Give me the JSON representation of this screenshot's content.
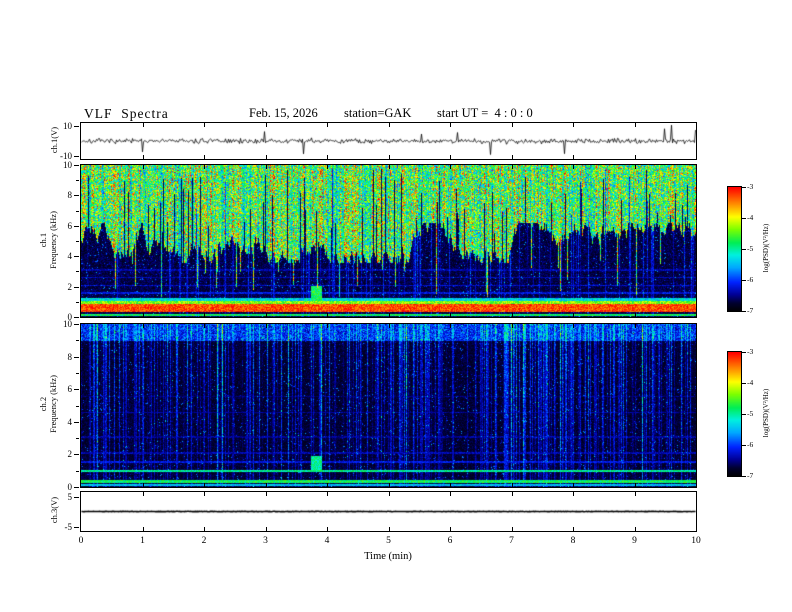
{
  "header": {
    "title": "VLF  Spectra",
    "date": "Feb. 15, 2026",
    "station_label": "station=GAK",
    "start_ut_label": "start UT =  4 : 0 : 0"
  },
  "xaxis": {
    "label": "Time (min)",
    "min": 0,
    "max": 10,
    "ticks": [
      0,
      1,
      2,
      3,
      4,
      5,
      6,
      7,
      8,
      9,
      10
    ]
  },
  "colorbar": {
    "label": "log(PSD)(V²/Hz)",
    "ticks": [
      -3,
      -4,
      -5,
      -6,
      -7
    ],
    "top_value": -3,
    "bottom_value": -7
  },
  "colormap_stops": [
    [
      0.0,
      "#000006"
    ],
    [
      0.06,
      "#00002f"
    ],
    [
      0.13,
      "#000096"
    ],
    [
      0.23,
      "#0022ff"
    ],
    [
      0.35,
      "#00aaff"
    ],
    [
      0.45,
      "#00f0e0"
    ],
    [
      0.55,
      "#00ee55"
    ],
    [
      0.66,
      "#7dff00"
    ],
    [
      0.76,
      "#ffff00"
    ],
    [
      0.87,
      "#ff8800"
    ],
    [
      1.0,
      "#ff0000"
    ]
  ],
  "chart_data": [
    {
      "id": "ch1_waveform",
      "type": "line",
      "ylabel": "ch.1(V)",
      "units": "V",
      "ylim": [
        -12,
        12
      ],
      "yticks": [
        10,
        -10
      ],
      "seed": 7,
      "noise_amp": 2.4,
      "spike_prob": 0.022,
      "spike_amp": 9,
      "line_width": 0.8,
      "description": "broadband noise around 0 V with intermittent impulsive spikes reaching about ±10 V over 0–10 min"
    },
    {
      "id": "ch1_spectrogram",
      "type": "heatmap",
      "channel": "ch.1",
      "ylabel": "Frequency (kHz)",
      "ylim": [
        0,
        10
      ],
      "yticks": [
        10,
        8,
        6,
        4,
        2,
        0
      ],
      "yminor": [
        9,
        7,
        5,
        3,
        1
      ],
      "zlabel": "log(PSD)(V²/Hz)",
      "zrange": [
        -7,
        -3
      ],
      "seed": 42,
      "model": {
        "upper_emission": {
          "enabled": true,
          "boundary_khz": 4.9,
          "boundary_jitter": 1.3,
          "mean": 0.5,
          "var": 0.55
        },
        "floor": {
          "mean": 0.03,
          "var": 0.09,
          "speckle_prob": 0.05,
          "speckle_gain": 0.3
        },
        "streaks": {
          "prob": 0.16,
          "gain_min": 0.06,
          "gain_max": 0.32
        },
        "dark_columns_prob": 0.1,
        "bright_columns_prob": 0.055,
        "hlines": [
          {
            "f": 0.62,
            "halfwidth": 0.27,
            "v": 0.93,
            "jitter": 0.18
          },
          {
            "f": 0.97,
            "halfwidth": 0.1,
            "v": 0.66,
            "jitter": 0.22
          },
          {
            "f": 1.18,
            "halfwidth": 0.08,
            "v": 0.42,
            "jitter": 0.2
          },
          {
            "f": 0.17,
            "halfwidth": 0.09,
            "v": 0.55,
            "jitter": 0.15
          },
          {
            "f": 1.62,
            "halfwidth": 0.05,
            "v": 0.2,
            "jitter": 0.12
          },
          {
            "f": 2.12,
            "halfwidth": 0.05,
            "v": 0.18,
            "jitter": 0.12
          },
          {
            "f": 2.62,
            "halfwidth": 0.05,
            "v": 0.16,
            "jitter": 0.1
          },
          {
            "f": 3.12,
            "halfwidth": 0.04,
            "v": 0.15,
            "jitter": 0.1
          }
        ],
        "blob": {
          "t": 3.82,
          "f": 1.5,
          "dt": 0.09,
          "df": 0.55,
          "v": 0.55
        },
        "description": "strong green/yellow impulsive hiss above ~5 kHz with ragged lower edge, dark band 1.5–5 kHz crossed by faint horizontal lines and vertical streaks, intense red band near 0.4–0.9 kHz, green narrowband line near 0.2 kHz, small green patch near t=3.8 min / 1.5 kHz"
      }
    },
    {
      "id": "ch2_spectrogram",
      "type": "heatmap",
      "channel": "ch.2",
      "ylabel": "Frequency (kHz)",
      "ylim": [
        0,
        10
      ],
      "yticks": [
        10,
        8,
        6,
        4,
        2,
        0
      ],
      "yminor": [
        9,
        7,
        5,
        3,
        1
      ],
      "zlabel": "log(PSD)(V²/Hz)",
      "zrange": [
        -7,
        -3
      ],
      "seed": 1234,
      "model": {
        "upper_emission": {
          "enabled": false
        },
        "floor": {
          "mean": 0.025,
          "var": 0.07,
          "speckle_prob": 0.05,
          "speckle_gain": 0.28
        },
        "streaks": {
          "prob": 0.42,
          "gain_min": 0.04,
          "gain_max": 0.34
        },
        "green_columns_prob": 0.02,
        "top_enhance": {
          "fmin": 9.0,
          "mean_add": 0.07,
          "var_add": 0.2
        },
        "hlines": [
          {
            "f": 1.02,
            "halfwidth": 0.08,
            "v": 0.5,
            "jitter": 0.15
          },
          {
            "f": 0.38,
            "halfwidth": 0.11,
            "v": 0.55,
            "jitter": 0.15
          },
          {
            "f": 0.15,
            "halfwidth": 0.06,
            "v": 0.38,
            "jitter": 0.12
          },
          {
            "f": 1.55,
            "halfwidth": 0.05,
            "v": 0.2,
            "jitter": 0.1
          },
          {
            "f": 2.1,
            "halfwidth": 0.05,
            "v": 0.15,
            "jitter": 0.1
          },
          {
            "f": 3.1,
            "halfwidth": 0.04,
            "v": 0.13,
            "jitter": 0.1
          },
          {
            "f": 4.6,
            "halfwidth": 0.04,
            "v": 0.13,
            "jitter": 0.08
          },
          {
            "f": 5.6,
            "halfwidth": 0.04,
            "v": 0.11,
            "jitter": 0.08
          }
        ],
        "blob": {
          "t": 3.82,
          "f": 1.45,
          "dt": 0.09,
          "df": 0.5,
          "v": 0.5
        },
        "description": "mostly dark background crossed by dense blue/cyan vertical impulsive streaks; narrowband cyan line near 1 kHz, green band near 0.4 kHz, faint lines near 2, 3, 4.6 and 5.6 kHz, small green patch near t=3.8 min / 1.5 kHz"
      }
    },
    {
      "id": "ch3_waveform",
      "type": "line",
      "ylabel": "ch.3(V)",
      "units": "V",
      "ylim": [
        -6.5,
        6.5
      ],
      "yticks": [
        5,
        -5
      ],
      "seed": 99,
      "noise_amp": 0.12,
      "spike_prob": 0,
      "spike_amp": 0,
      "line_width": 1.6,
      "description": "flat trace at 0 V for the whole interval"
    }
  ]
}
